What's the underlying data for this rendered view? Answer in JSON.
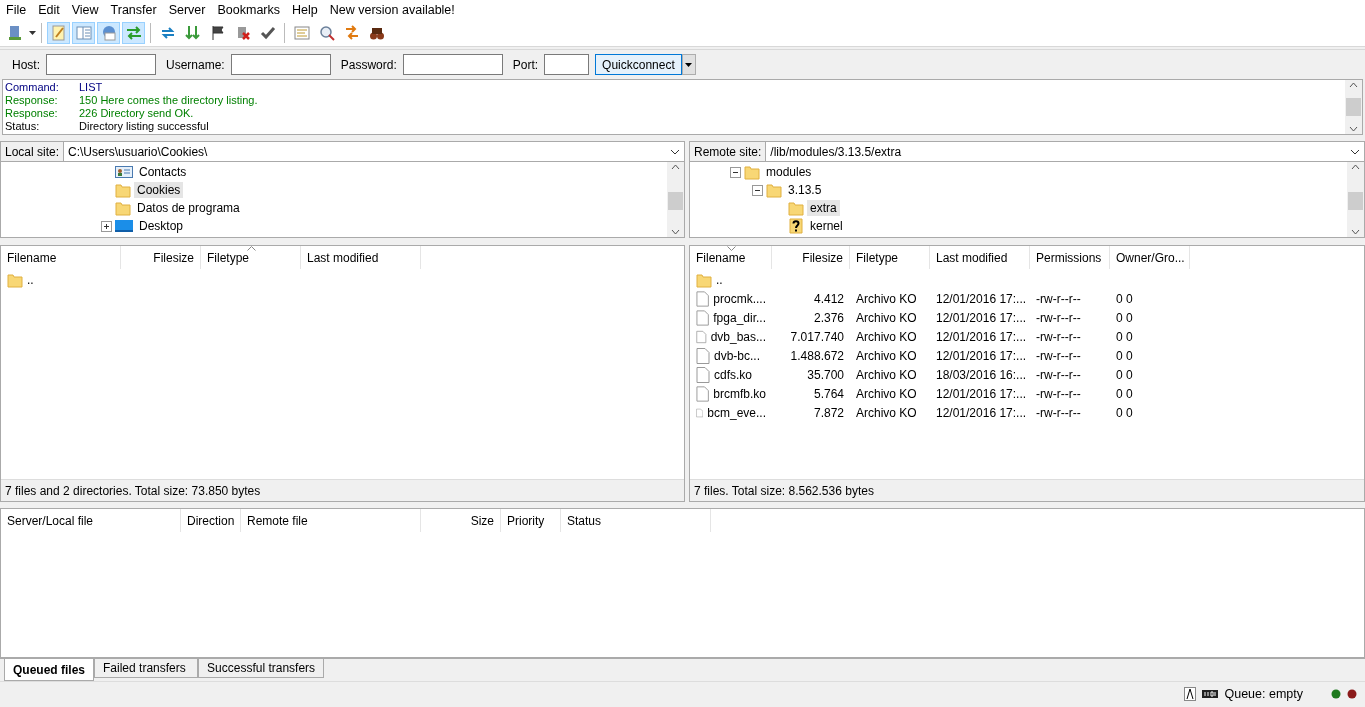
{
  "menu": [
    "File",
    "Edit",
    "View",
    "Transfer",
    "Server",
    "Bookmarks",
    "Help",
    "New version available!"
  ],
  "toolbar": {
    "toggles": [
      {
        "on": true
      },
      {
        "on": true
      },
      {
        "on": true
      },
      {
        "on": true
      }
    ]
  },
  "quickconnect": {
    "fields": [
      {
        "label": "Host:"
      },
      {
        "label": "Username:"
      },
      {
        "label": "Password:"
      },
      {
        "label": "Port:"
      }
    ],
    "button": "Quickconnect"
  },
  "log": [
    {
      "kind": "command",
      "label": "Command:",
      "text": "LIST"
    },
    {
      "kind": "response",
      "label": "Response:",
      "text": "150 Here comes the directory listing."
    },
    {
      "kind": "response",
      "label": "Response:",
      "text": "226 Directory send OK."
    },
    {
      "kind": "status",
      "label": "Status:",
      "text": "Directory listing successful"
    }
  ],
  "local": {
    "site_label": "Local site:",
    "path": "C:\\Users\\usuario\\Cookies\\",
    "tree": [
      {
        "kind": "contacts",
        "name": "Contacts",
        "selected": false
      },
      {
        "kind": "folder",
        "name": "Cookies",
        "selected": true
      },
      {
        "kind": "folder",
        "name": "Datos de programa",
        "selected": false
      },
      {
        "kind": "desktop",
        "name": "Desktop",
        "selected": false,
        "expanded": false
      }
    ],
    "columns": [
      {
        "label": "Filename",
        "sorted": false
      },
      {
        "label": "Filesize",
        "sorted": false
      },
      {
        "label": "Filetype",
        "sorted": true,
        "descending": false
      },
      {
        "label": "Last modified",
        "sorted": false
      }
    ],
    "rows": [
      {
        "kind": "folder",
        "cells": [
          ".."
        ]
      }
    ],
    "status": "7 files and 2 directories. Total size: 73.850 bytes"
  },
  "remote": {
    "site_label": "Remote site:",
    "path": "/lib/modules/3.13.5/extra",
    "tree": [
      {
        "kind": "folder",
        "name": "modules",
        "selected": false,
        "expanded": true,
        "children": [
          {
            "kind": "folder",
            "name": "3.13.5",
            "selected": false,
            "expanded": true,
            "children": [
              {
                "kind": "folder",
                "name": "extra",
                "selected": true
              },
              {
                "kind": "unknown",
                "name": "kernel",
                "selected": false
              }
            ]
          }
        ]
      }
    ],
    "columns": [
      {
        "label": "Filename",
        "sorted": true,
        "descending": true
      },
      {
        "label": "Filesize",
        "sorted": false
      },
      {
        "label": "Filetype",
        "sorted": false
      },
      {
        "label": "Last modified",
        "sorted": false
      },
      {
        "label": "Permissions",
        "sorted": false
      },
      {
        "label": "Owner/Gro...",
        "sorted": false
      }
    ],
    "rows": [
      {
        "kind": "folder",
        "cells": [
          ".."
        ]
      },
      {
        "kind": "file",
        "cells": [
          "procmk....",
          "4.412",
          "Archivo KO",
          "12/01/2016 17:...",
          "-rw-r--r--",
          "0 0"
        ]
      },
      {
        "kind": "file",
        "cells": [
          "fpga_dir...",
          "2.376",
          "Archivo KO",
          "12/01/2016 17:...",
          "-rw-r--r--",
          "0 0"
        ]
      },
      {
        "kind": "file",
        "cells": [
          "dvb_bas...",
          "7.017.740",
          "Archivo KO",
          "12/01/2016 17:...",
          "-rw-r--r--",
          "0 0"
        ]
      },
      {
        "kind": "file",
        "cells": [
          "dvb-bc...",
          "1.488.672",
          "Archivo KO",
          "12/01/2016 17:...",
          "-rw-r--r--",
          "0 0"
        ]
      },
      {
        "kind": "file",
        "cells": [
          "cdfs.ko",
          "35.700",
          "Archivo KO",
          "18/03/2016 16:...",
          "-rw-r--r--",
          "0 0"
        ]
      },
      {
        "kind": "file",
        "cells": [
          "brcmfb.ko",
          "5.764",
          "Archivo KO",
          "12/01/2016 17:...",
          "-rw-r--r--",
          "0 0"
        ]
      },
      {
        "kind": "file",
        "cells": [
          "bcm_eve...",
          "7.872",
          "Archivo KO",
          "12/01/2016 17:...",
          "-rw-r--r--",
          "0 0"
        ]
      }
    ],
    "status": "7 files. Total size: 8.562.536 bytes"
  },
  "queue": {
    "columns": [
      "Server/Local file",
      "Direction",
      "Remote file",
      "Size",
      "Priority",
      "Status"
    ]
  },
  "tabs": [
    {
      "label": "Queued files",
      "selected": true
    },
    {
      "label": "Failed transfers",
      "selected": false
    },
    {
      "label": "Successful transfers",
      "selected": false
    }
  ],
  "status_bar": {
    "queue": "Queue: empty",
    "lights": [
      {
        "color": "#1e7a1e"
      },
      {
        "color": "#8b1a1a"
      }
    ]
  }
}
